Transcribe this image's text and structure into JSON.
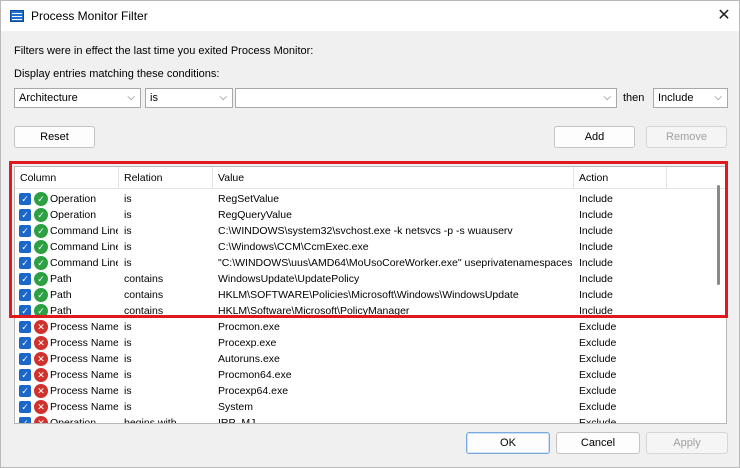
{
  "window": {
    "title": "Process Monitor Filter"
  },
  "info_text": "Filters were in effect the last time you exited Process Monitor:",
  "conditions_label": "Display entries matching these conditions:",
  "filter_row": {
    "column": "Architecture",
    "relation": "is",
    "value": "",
    "then_label": "then",
    "action": "Include"
  },
  "buttons": {
    "reset": "Reset",
    "add": "Add",
    "remove": "Remove",
    "ok": "OK",
    "cancel": "Cancel",
    "apply": "Apply"
  },
  "list": {
    "headers": [
      "Column",
      "Relation",
      "Value",
      "Action"
    ],
    "rows": [
      {
        "column": "Operation",
        "relation": "is",
        "value": "RegSetValue",
        "action": "Include",
        "status": "include"
      },
      {
        "column": "Operation",
        "relation": "is",
        "value": "RegQueryValue",
        "action": "Include",
        "status": "include"
      },
      {
        "column": "Command Line",
        "relation": "is",
        "value": "C:\\WINDOWS\\system32\\svchost.exe -k netsvcs -p -s wuauserv",
        "action": "Include",
        "status": "include"
      },
      {
        "column": "Command Line",
        "relation": "is",
        "value": "C:\\Windows\\CCM\\CcmExec.exe",
        "action": "Include",
        "status": "include"
      },
      {
        "column": "Command Line",
        "relation": "is",
        "value": "\"C:\\WINDOWS\\uus\\AMD64\\MoUsoCoreWorker.exe\" useprivatenamespaces",
        "action": "Include",
        "status": "include"
      },
      {
        "column": "Path",
        "relation": "contains",
        "value": "WindowsUpdate\\UpdatePolicy",
        "action": "Include",
        "status": "include"
      },
      {
        "column": "Path",
        "relation": "contains",
        "value": "HKLM\\SOFTWARE\\Policies\\Microsoft\\Windows\\WindowsUpdate",
        "action": "Include",
        "status": "include"
      },
      {
        "column": "Path",
        "relation": "contains",
        "value": "HKLM\\Software\\Microsoft\\PolicyManager",
        "action": "Include",
        "status": "include"
      },
      {
        "column": "Process Name",
        "relation": "is",
        "value": "Procmon.exe",
        "action": "Exclude",
        "status": "exclude"
      },
      {
        "column": "Process Name",
        "relation": "is",
        "value": "Procexp.exe",
        "action": "Exclude",
        "status": "exclude"
      },
      {
        "column": "Process Name",
        "relation": "is",
        "value": "Autoruns.exe",
        "action": "Exclude",
        "status": "exclude"
      },
      {
        "column": "Process Name",
        "relation": "is",
        "value": "Procmon64.exe",
        "action": "Exclude",
        "status": "exclude"
      },
      {
        "column": "Process Name",
        "relation": "is",
        "value": "Procexp64.exe",
        "action": "Exclude",
        "status": "exclude"
      },
      {
        "column": "Process Name",
        "relation": "is",
        "value": "System",
        "action": "Exclude",
        "status": "exclude"
      },
      {
        "column": "Operation",
        "relation": "begins with",
        "value": "IRP_MJ_",
        "action": "Exclude",
        "status": "exclude"
      }
    ]
  },
  "colors": {
    "highlight": "#e0191f",
    "include": "#2ea043",
    "exclude": "#d0312d",
    "checkbox": "#1a66c9"
  }
}
